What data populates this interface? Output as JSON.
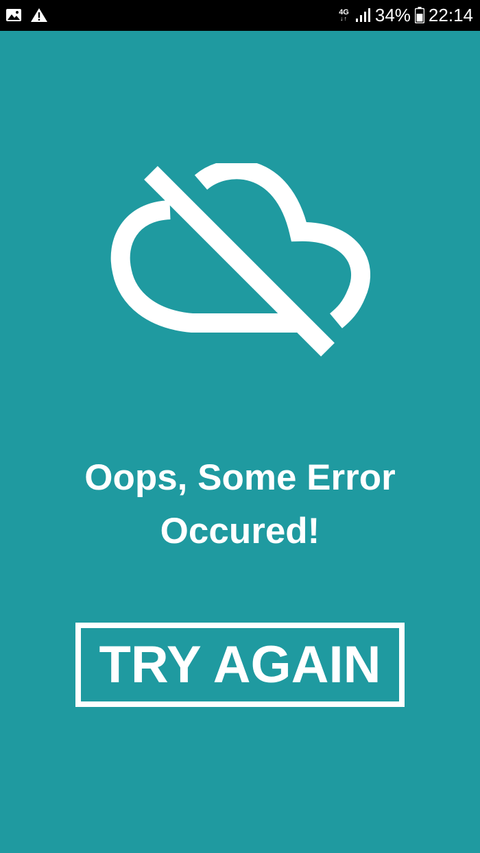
{
  "status_bar": {
    "left_icons": [
      "gallery-icon",
      "warning-icon"
    ],
    "network_type": "4G",
    "network_arrows": "↓↑",
    "signal_icon": "signal-bars-icon",
    "battery_percent": "34%",
    "battery_icon": "battery-icon",
    "time": "22:14"
  },
  "error_screen": {
    "icon": "cloud-off-icon",
    "message_line1": "Oops, Some Error",
    "message_line2": "Occured!",
    "button_label": "TRY AGAIN"
  },
  "colors": {
    "background": "#1f9aa0",
    "foreground": "#ffffff",
    "status_bar": "#000000"
  }
}
